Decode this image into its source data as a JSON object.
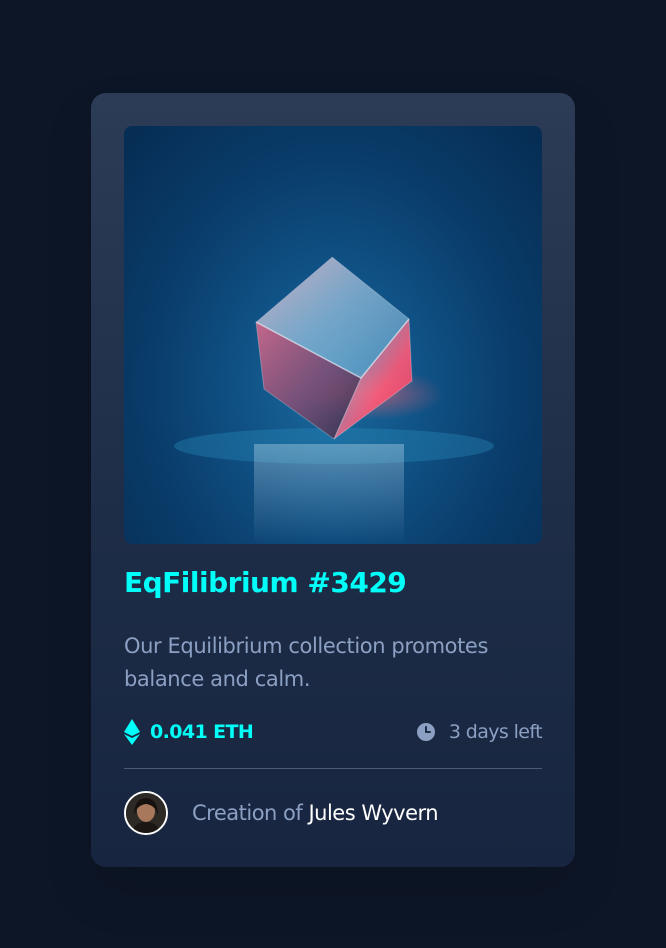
{
  "card": {
    "image_alt": "Equilibrium crystal cube",
    "title": "EqFilibrium #3429",
    "description": "Our Equilibrium collection promotes balance and calm.",
    "price": "0.041 ETH",
    "time_left": "3 days left",
    "creator_prefix": "Creation of ",
    "creator_name": "Jules Wyvern"
  },
  "icons": {
    "price": "ethereum-icon",
    "time": "clock-icon",
    "creator": "avatar"
  },
  "colors": {
    "page_background": "#0d1627",
    "card_background": "#1e2d47",
    "accent_cyan": "#00fff8",
    "muted_text": "#8ba0c3",
    "white_text": "#ffffff",
    "divider": "#4a5b78"
  }
}
